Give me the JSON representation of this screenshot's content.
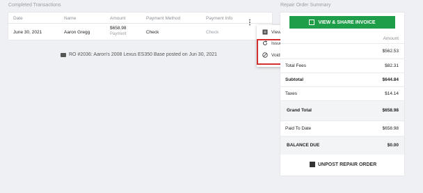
{
  "completed_transactions": {
    "title": "Completed Transactions",
    "headers": [
      "Date",
      "Name",
      "Amount",
      "Payment Method",
      "Payment Info"
    ],
    "row": {
      "date": "June 30, 2021",
      "name": "Aaron Gregg",
      "amount": "$658.98",
      "amount_type": "Payment",
      "method": "Check",
      "info": "Check"
    }
  },
  "context_menu": {
    "items": [
      {
        "label": "View Invoice",
        "icon": "invoice-icon"
      },
      {
        "label": "Issue Refund",
        "icon": "refresh-icon"
      },
      {
        "label": "Void transaction",
        "icon": "void-icon"
      }
    ],
    "highlight_color": "#d32f2f"
  },
  "ro_note": "RO #2036: Aaron's 2008 Lexus ES350 Base posted on Jun 30, 2021",
  "summary": {
    "title": "Repair Order Summary",
    "share_button": "VIEW & SHARE INVOICE",
    "amount_header": "Amount",
    "rows": {
      "row1": {
        "label": "",
        "value": "$562.53"
      },
      "total_fees": {
        "label": "Total Fees",
        "value": "$82.31"
      },
      "subtotal": {
        "label": "Subtotal",
        "value": "$644.84"
      },
      "taxes": {
        "label": "Taxes",
        "value": "$14.14"
      },
      "grand_total": {
        "label": "Grand Total",
        "value": "$658.98"
      },
      "paid_to_date": {
        "label": "Paid To Date",
        "value": "$658.98"
      },
      "balance_due": {
        "label": "BALANCE DUE",
        "value": "$0.00"
      }
    },
    "unpost_button": "UNPOST REPAIR ORDER"
  },
  "colors": {
    "primary_green": "#1e9e48",
    "background": "#eef0f3"
  }
}
